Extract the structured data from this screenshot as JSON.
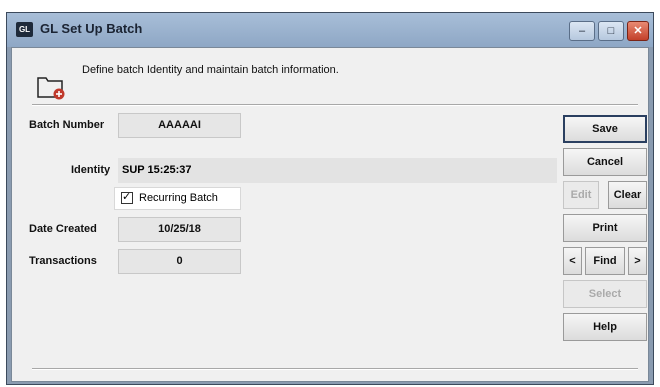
{
  "window": {
    "app_badge": "GL",
    "title": "GL Set Up Batch",
    "controls": {
      "minimize": "–",
      "maximize": "□",
      "close": "✕"
    }
  },
  "header": {
    "text": "Define batch Identity and maintain batch information."
  },
  "form": {
    "batch_number_label": "Batch Number",
    "batch_number_value": "AAAAAI",
    "identity_label": "Identity",
    "identity_value": "SUP 15:25:37",
    "recurring_label": "Recurring Batch",
    "recurring_checked": true,
    "date_created_label": "Date Created",
    "date_created_value": "10/25/18",
    "transactions_label": "Transactions",
    "transactions_value": "0"
  },
  "buttons": {
    "save": "Save",
    "cancel": "Cancel",
    "edit": "Edit",
    "clear": "Clear",
    "print": "Print",
    "prev": "<",
    "find": "Find",
    "next": ">",
    "select": "Select",
    "help": "Help"
  },
  "icons": {
    "folder": "folder-add-icon",
    "check": "✓"
  }
}
